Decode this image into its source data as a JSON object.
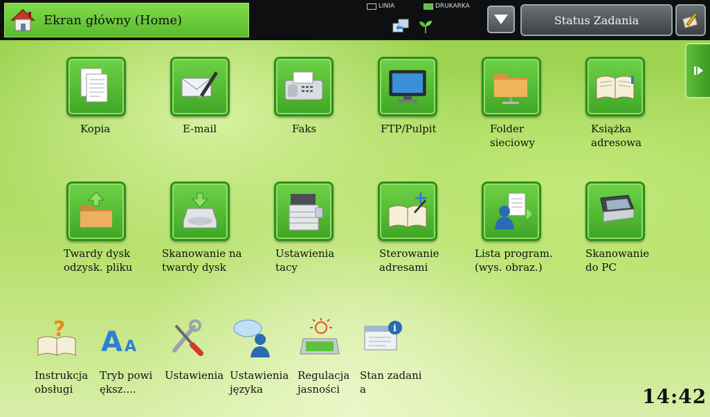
{
  "header": {
    "home_label": "Ekran główny (Home)",
    "indicator_linia": "LINIA",
    "indicator_drukarka": "DRUKARKA",
    "status_label": "Status Zadania"
  },
  "tiles": [
    {
      "label": "Kopia",
      "icon": "copy-icon"
    },
    {
      "label": "E-mail",
      "icon": "email-icon"
    },
    {
      "label": "Faks",
      "icon": "fax-icon"
    },
    {
      "label": "FTP/Pulpit",
      "icon": "monitor-icon"
    },
    {
      "label": "Folder\nsieciowy",
      "icon": "folder-icon"
    },
    {
      "label": "Książka\nadresowa",
      "icon": "address-book-icon"
    },
    {
      "label": "Twardy dysk\nodzysk. pliku",
      "icon": "folder-retrieve-icon"
    },
    {
      "label": "Skanowanie na\ntwardy dysk",
      "icon": "scan-to-disk-icon"
    },
    {
      "label": "Ustawienia\ntacy",
      "icon": "printer-tray-icon"
    },
    {
      "label": "Sterowanie\nadresami",
      "icon": "address-control-icon"
    },
    {
      "label": "Lista program.\n(wys. obraz.)",
      "icon": "program-list-icon"
    },
    {
      "label": "Skanowanie\ndo PC",
      "icon": "scanner-icon"
    }
  ],
  "shortcuts": [
    {
      "label": "Instrukcja\nobsługi",
      "icon": "help-book-icon"
    },
    {
      "label": "Tryb powi\nększ....",
      "icon": "font-size-icon"
    },
    {
      "label": "Ustawienia",
      "icon": "tools-icon"
    },
    {
      "label": "Ustawienia\njęzyka",
      "icon": "language-icon"
    },
    {
      "label": "Regulacja\njasności",
      "icon": "brightness-icon"
    },
    {
      "label": "Stan zadani\na",
      "icon": "job-status-icon"
    }
  ],
  "clock": "14:42",
  "colors": {
    "accent_green": "#5ab92e",
    "topbar": "#0e0f10"
  }
}
